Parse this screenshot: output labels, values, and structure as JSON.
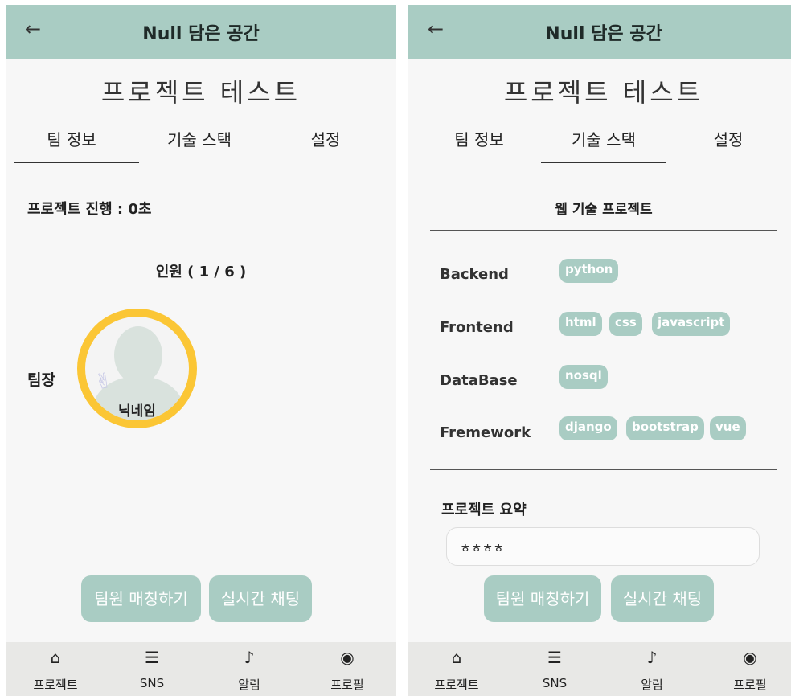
{
  "app": {
    "title": "Null 담은 공간",
    "back_icon": "←"
  },
  "project": {
    "title": "프로젝트 테스트"
  },
  "tabs": [
    {
      "label": "팀 정보"
    },
    {
      "label": "기술 스택"
    },
    {
      "label": "설정"
    }
  ],
  "team_info": {
    "progress": "프로젝트 진행 : 0초",
    "members": "인원 ( 1 / 6 )",
    "leader_label": "팀장",
    "leader_nickname": "닉네임"
  },
  "tech_stack": {
    "section_title": "웹 기술 프로젝트",
    "rows": [
      {
        "label": "Backend",
        "chips": [
          "python"
        ]
      },
      {
        "label": "Frontend",
        "chips": [
          "html",
          "css",
          "javascript"
        ]
      },
      {
        "label": "DataBase",
        "chips": [
          "nosql"
        ]
      },
      {
        "label": "Fremework",
        "chips": [
          "django",
          "bootstrap",
          "vue"
        ]
      }
    ],
    "summary_label": "프로젝트 요약",
    "summary_value": "ㅎㅎㅎㅎ"
  },
  "actions": {
    "match_label": "팀원 매칭하기",
    "chat_label": "실시간 채팅"
  },
  "nav": [
    {
      "label": "프로젝트",
      "icon": "home-icon"
    },
    {
      "label": "SNS",
      "icon": "document-icon"
    },
    {
      "label": "알림",
      "icon": "bell-icon"
    },
    {
      "label": "프로필",
      "icon": "profile-icon"
    }
  ],
  "colors": {
    "accent": "#a9ccc3",
    "avatar_ring": "#fbc635",
    "background": "#f7f7f7",
    "nav_background": "#e8e8e6"
  }
}
